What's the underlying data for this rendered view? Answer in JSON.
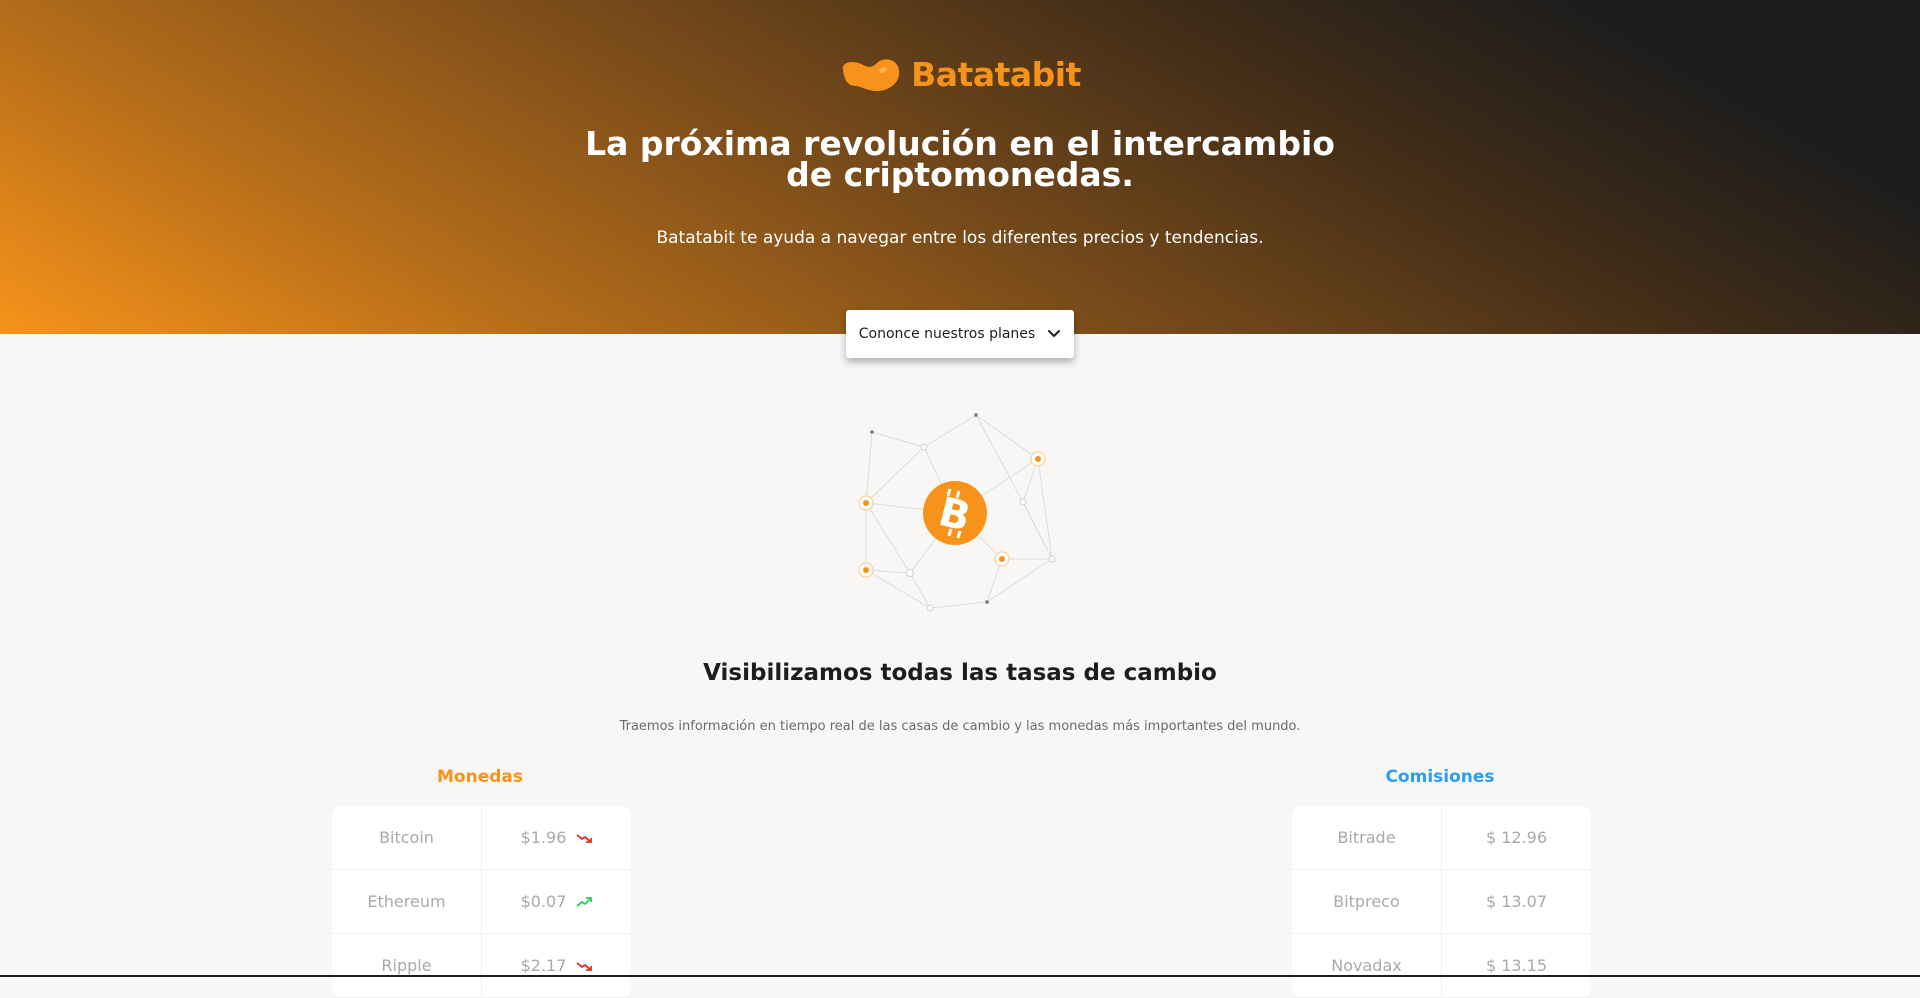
{
  "brand": {
    "name": "Batatabit",
    "accent": "#f7931a",
    "secondary": "#2a9ff0",
    "dark": "#1d1d1d"
  },
  "hero": {
    "title": "La próxima revolución en el intercambio de criptomonedas.",
    "subtitle": "Batatabit te ayuda a navegar entre los diferentes precios y tendencias.",
    "cta_label": "Cononce nuestros planes",
    "cta_icon": "chevron-down-icon"
  },
  "rates": {
    "title": "Visibilizamos todas las tasas de cambio",
    "subtitle": "Traemos información en tiempo real de las casas de cambio y las monedas más importantes del mundo.",
    "coins": {
      "heading": "Monedas",
      "rows": [
        {
          "name": "Bitcoin",
          "price": "$1.96",
          "trend": "down"
        },
        {
          "name": "Ethereum",
          "price": "$0.07",
          "trend": "up"
        },
        {
          "name": "Ripple",
          "price": "$2.17",
          "trend": "down"
        }
      ]
    },
    "fees": {
      "heading": "Comisiones",
      "rows": [
        {
          "name": "Bitrade",
          "price": "$ 12.96"
        },
        {
          "name": "Bitpreco",
          "price": "$ 13.07"
        },
        {
          "name": "Novadax",
          "price": "$ 13.15"
        }
      ]
    }
  },
  "trend_colors": {
    "up": "#23d35a",
    "down": "#e1301f"
  }
}
